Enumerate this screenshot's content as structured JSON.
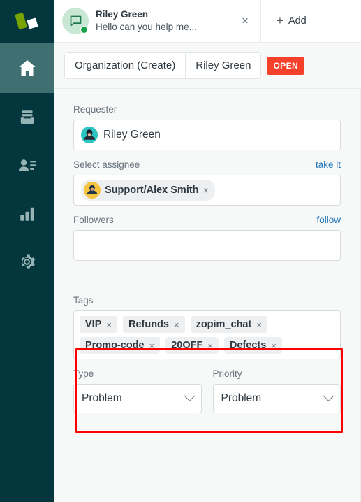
{
  "sidebar": {
    "brand_icon": "zendesk-logo",
    "items": [
      {
        "name": "home",
        "icon": "home-icon",
        "active": true
      },
      {
        "name": "views",
        "icon": "views-tray-icon",
        "active": false
      },
      {
        "name": "customers",
        "icon": "customers-icon",
        "active": false
      },
      {
        "name": "reporting",
        "icon": "bar-chart-icon",
        "active": false
      },
      {
        "name": "settings",
        "icon": "gear-icon",
        "active": false
      }
    ]
  },
  "tabstrip": {
    "chat_tab": {
      "title": "Riley Green",
      "subtitle": "Hello can you help me...",
      "avatar_icon": "chat-bubble-icon",
      "status": "online",
      "close_label": "×"
    },
    "add_tab": {
      "plus": "+",
      "label": "Add"
    }
  },
  "breadcrumb": {
    "segments": [
      {
        "label": "Organization (Create)"
      },
      {
        "label": "Riley Green"
      }
    ],
    "status_badge": "OPEN",
    "status_color": "#f5402c"
  },
  "properties": {
    "requester": {
      "label": "Requester",
      "value": "Riley Green",
      "avatar": "requester-avatar"
    },
    "assignee": {
      "label": "Select assignee",
      "action_label": "take it",
      "value": "Support/Alex Smith",
      "remove_label": "×",
      "avatar": "assignee-avatar"
    },
    "followers": {
      "label": "Followers",
      "action_label": "follow",
      "value": "",
      "placeholder": ""
    },
    "tags": {
      "label": "Tags",
      "items": [
        {
          "label": "VIP",
          "remove": "×"
        },
        {
          "label": "Refunds",
          "remove": "×"
        },
        {
          "label": "zopim_chat",
          "remove": "×"
        },
        {
          "label": "Promo-code",
          "remove": "×"
        },
        {
          "label": "20OFF",
          "remove": "×"
        },
        {
          "label": "Defects",
          "remove": "×"
        }
      ]
    },
    "type": {
      "label": "Type",
      "value": "Problem"
    },
    "priority": {
      "label": "Priority",
      "value": "Problem"
    }
  },
  "annotation": {
    "name": "tags-highlight-box",
    "color": "#fe0000"
  }
}
